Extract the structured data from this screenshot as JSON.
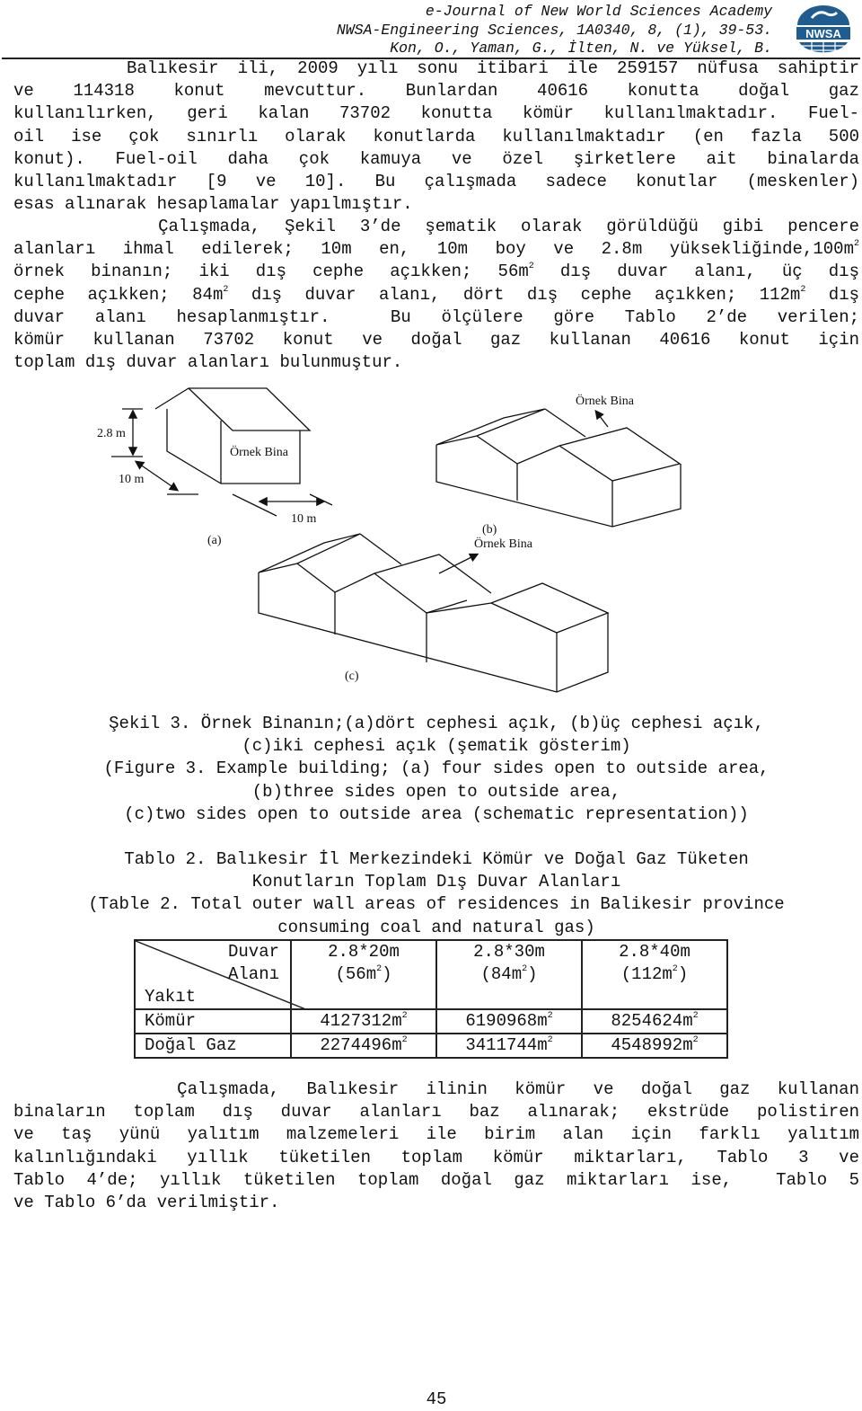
{
  "header": {
    "lines": [
      "e-Journal of New World Sciences Academy",
      "NWSA-Engineering Sciences, 1A0340, 8, (1), 39-53.",
      "Kon, O., Yaman, G., İlten, N. ve Yüksel, B."
    ],
    "logo_text": "NWSA"
  },
  "paragraph1": [
    [
      "      Balıkesir ili, 2009 yılı sonu itibari ile 259157 nüfusa sahiptir"
    ],
    [
      "ve 114318 konut mevcuttur. Bunlardan 40616 konutta doğal gaz"
    ],
    [
      "kullanılırken, geri kalan 73702 konutta kömür kullanılmaktadır. Fuel-"
    ],
    [
      "oil ise çok sınırlı olarak konutlarda kullanılmaktadır (en fazla 500"
    ],
    [
      "konut). Fuel-oil daha çok kamuya ve özel şirketlere ait binalarda"
    ],
    [
      "kullanılmaktadır [9 ve 10]. Bu çalışmada sadece konutlar (meskenler)"
    ],
    [
      "esas alınarak hesaplamalar yapılmıştır."
    ]
  ],
  "paragraph2": [
    [
      "      Çalışmada, Şekil 3’de şematik olarak görüldüğü gibi pencere"
    ],
    [
      "alanları ihmal edilerek; 10m en, 10m boy ve 2.8m yüksekliğinde,100m",
      {
        "sup": "2"
      }
    ],
    [
      "örnek binanın; iki dış cephe açıkken; 56m",
      {
        "sup": "2"
      },
      " dış duvar alanı, üç dış"
    ],
    [
      "cephe açıkken; 84m",
      {
        "sup": "2"
      },
      " dış duvar alanı, dört dış cephe açıkken; 112m",
      {
        "sup": "2"
      },
      " dış"
    ],
    [
      "duvar alanı hesaplanmıştır.  Bu ölçülere göre Tablo 2’de verilen;"
    ],
    [
      "kömür kullanan 73702 konut ve doğal gaz kullanan 40616 konut için"
    ],
    [
      "toplam dış duvar alanları bulunmuştur."
    ]
  ],
  "figure": {
    "label_height": "2.8 m",
    "label_depth": "10 m",
    "label_width": "10 m",
    "label_building_a": "Örnek Bina",
    "label_building_b": "Örnek Bina",
    "label_building_bc": "Örnek Bina",
    "sub_a": "(a)",
    "sub_b": "(b)",
    "sub_c": "(c)"
  },
  "figure_caption": [
    "Şekil 3. Örnek Binanın;(a)dört cephesi açık, (b)üç cephesi açık,",
    "(c)iki cephesi açık (şematik gösterim)",
    "(Figure 3. Example building; (a) four sides open to outside area,",
    "(b)three sides open to outside area,",
    "(c)two sides open to outside area (schematic representation))"
  ],
  "table_caption": [
    "Tablo 2. Balıkesir İl Merkezindeki Kömür ve Doğal Gaz Tüketen",
    "Konutların Toplam Dış Duvar Alanları",
    "(Table 2. Total outer wall areas of residences in Balikesir province",
    "consuming coal and natural gas)"
  ],
  "table": {
    "corner_top": [
      "Duvar",
      "Alanı"
    ],
    "corner_bottom": "Yakıt",
    "columns": [
      {
        "dim": "2.8*20m",
        "area": "(56m",
        "unit": "2",
        ")": ")"
      },
      {
        "dim": "2.8*30m",
        "area": "(84m",
        "unit": "2"
      },
      {
        "dim": "2.8*40m",
        "area": "(112m",
        "unit": "2"
      }
    ],
    "rows": [
      {
        "label": "Kömür",
        "values": [
          "4127312m",
          "6190968m",
          "8254624m"
        ]
      },
      {
        "label": "Doğal Gaz",
        "values": [
          "2274496m",
          "3411744m",
          "4548992m"
        ]
      }
    ],
    "unit_sup": "2"
  },
  "paragraph3": [
    [
      "      Çalışmada, Balıkesir ilinin kömür ve doğal gaz kullanan"
    ],
    [
      "binaların toplam dış duvar alanları baz alınarak; ekstrüde polistiren"
    ],
    [
      "ve taş yünü yalıtım malzemeleri ile birim alan için farklı yalıtım"
    ],
    [
      "kalınlığındaki yıllık tüketilen toplam kömür miktarları, Tablo 3 ve"
    ],
    [
      "Tablo 4’de; yıllık tüketilen toplam doğal gaz miktarları ise,  Tablo 5"
    ],
    [
      "ve Tablo 6’da verilmiştir."
    ]
  ],
  "page_number": "45"
}
